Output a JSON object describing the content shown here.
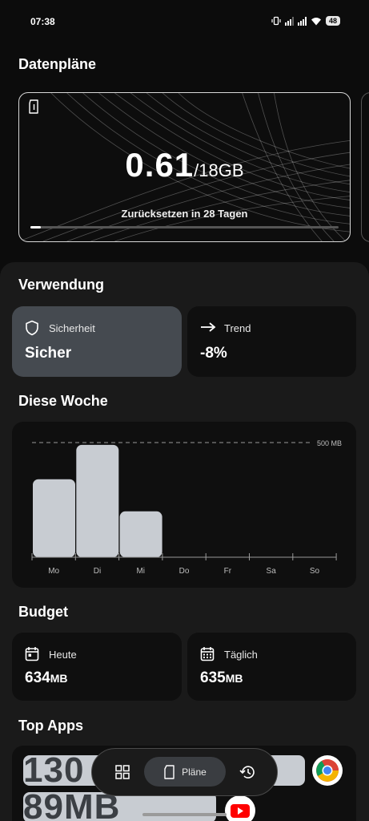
{
  "status_bar": {
    "time": "07:38",
    "battery": "48",
    "icons": [
      "vibrate-icon",
      "signal-icon",
      "signal-icon",
      "wifi-icon",
      "battery-icon"
    ]
  },
  "data_plans": {
    "title": "Datenpläne",
    "used": "0.61",
    "separator": "/",
    "total": "18GB",
    "reset_text": "Zurücksetzen in 28 Tagen",
    "progress_fraction": 0.034,
    "icon": "sim-card-icon"
  },
  "usage": {
    "title": "Verwendung",
    "security": {
      "label": "Sicherheit",
      "value": "Sicher",
      "icon": "shield-icon"
    },
    "trend": {
      "label": "Trend",
      "value": "-8%",
      "icon": "arrow-right-icon"
    }
  },
  "week": {
    "title": "Diese Woche",
    "chart_data": {
      "type": "bar",
      "categories": [
        "Mo",
        "Di",
        "Mi",
        "Do",
        "Fr",
        "Sa",
        "So"
      ],
      "values": [
        340,
        490,
        200,
        0,
        0,
        0,
        0
      ],
      "reference_line_label": "500 MB",
      "reference_line_value": 500,
      "ylim": [
        0,
        500
      ],
      "title": "",
      "xlabel": "",
      "ylabel": ""
    }
  },
  "budget": {
    "title": "Budget",
    "today": {
      "label": "Heute",
      "value": "634",
      "unit": "MB",
      "icon": "calendar-day-icon"
    },
    "daily": {
      "label": "Täglich",
      "value": "635",
      "unit": "MB",
      "icon": "calendar-grid-icon"
    }
  },
  "top_apps": {
    "title": "Top Apps",
    "apps": [
      {
        "value": "130",
        "icon": "chrome-icon",
        "bar_fraction": 0.95
      },
      {
        "value": "89MB",
        "icon": "youtube-icon",
        "bar_fraction": 0.65
      }
    ]
  },
  "nav": {
    "grid_icon": "grid-icon",
    "plans_label": "Pläne",
    "plans_icon": "sim-card-icon",
    "history_icon": "history-icon"
  },
  "colors": {
    "background": "#0c0c0c",
    "sheet": "#1a1a1a",
    "tile": "#0f0f0f",
    "security_tile": "#454a50",
    "bar": "#c8ccd2"
  }
}
